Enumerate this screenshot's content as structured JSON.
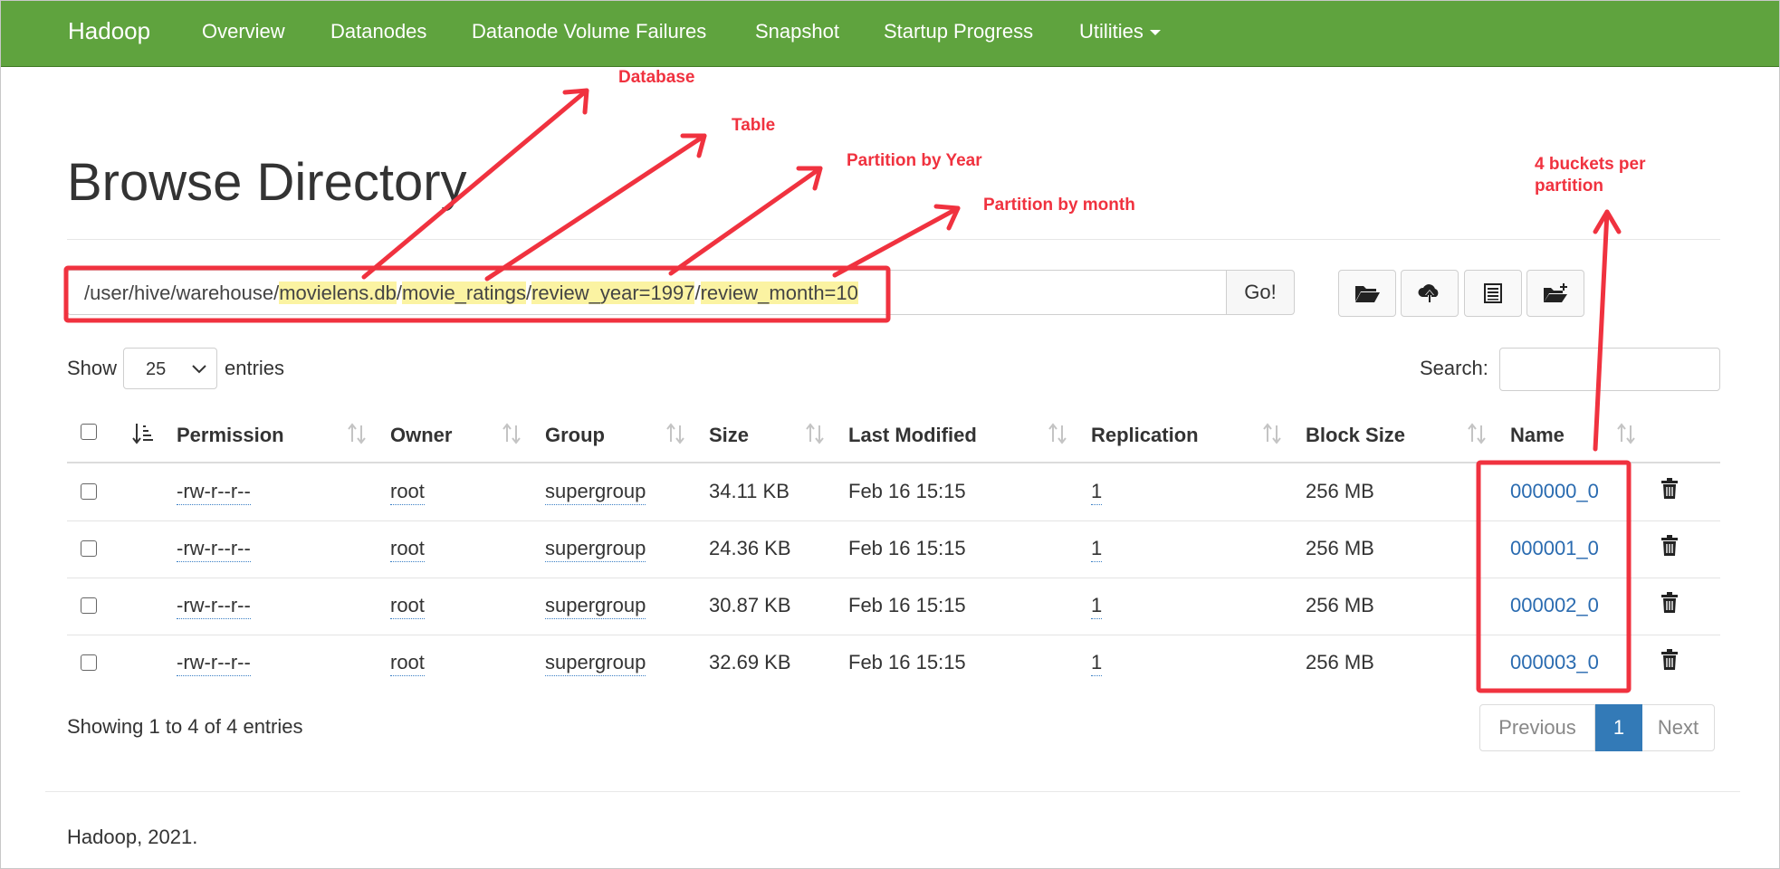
{
  "navbar": {
    "brand": "Hadoop",
    "items": [
      "Overview",
      "Datanodes",
      "Datanode Volume Failures",
      "Snapshot",
      "Startup Progress",
      "Utilities"
    ],
    "color": "#5fa33e"
  },
  "page": {
    "title": "Browse Directory"
  },
  "path": {
    "prefix": "/user/hive/warehouse/",
    "seg1": "movielens.db",
    "sep1": "/",
    "seg2": "movie_ratings",
    "sep2": "/",
    "seg3": "review_year=1997",
    "sep3": "/",
    "seg4": "review_month=10",
    "go_label": "Go!"
  },
  "toolbar": {
    "icons": [
      "folder-open-icon",
      "cloud-upload-icon",
      "list-icon",
      "create-folder-icon"
    ]
  },
  "entries": {
    "show_label": "Show",
    "value": "25",
    "suffix": "entries"
  },
  "search": {
    "label": "Search:",
    "value": ""
  },
  "table": {
    "headers": [
      "Permission",
      "Owner",
      "Group",
      "Size",
      "Last Modified",
      "Replication",
      "Block Size",
      "Name"
    ],
    "rows": [
      {
        "permission": "-rw-r--r--",
        "owner": "root",
        "group": "supergroup",
        "size": "34.11 KB",
        "modified": "Feb 16 15:15",
        "replication": "1",
        "block_size": "256 MB",
        "name": "000000_0"
      },
      {
        "permission": "-rw-r--r--",
        "owner": "root",
        "group": "supergroup",
        "size": "24.36 KB",
        "modified": "Feb 16 15:15",
        "replication": "1",
        "block_size": "256 MB",
        "name": "000001_0"
      },
      {
        "permission": "-rw-r--r--",
        "owner": "root",
        "group": "supergroup",
        "size": "30.87 KB",
        "modified": "Feb 16 15:15",
        "replication": "1",
        "block_size": "256 MB",
        "name": "000002_0"
      },
      {
        "permission": "-rw-r--r--",
        "owner": "root",
        "group": "supergroup",
        "size": "32.69 KB",
        "modified": "Feb 16 15:15",
        "replication": "1",
        "block_size": "256 MB",
        "name": "000003_0"
      }
    ]
  },
  "info": {
    "showing": "Showing 1 to 4 of 4 entries"
  },
  "pagination": {
    "previous": "Previous",
    "current": "1",
    "next": "Next"
  },
  "footer": {
    "text": "Hadoop, 2021."
  },
  "annotations": {
    "database": "Database",
    "table": "Table",
    "year": "Partition by Year",
    "month": "Partition by month",
    "buckets_line1": "4 buckets per",
    "buckets_line2": "partition",
    "color": "#f0323f"
  }
}
